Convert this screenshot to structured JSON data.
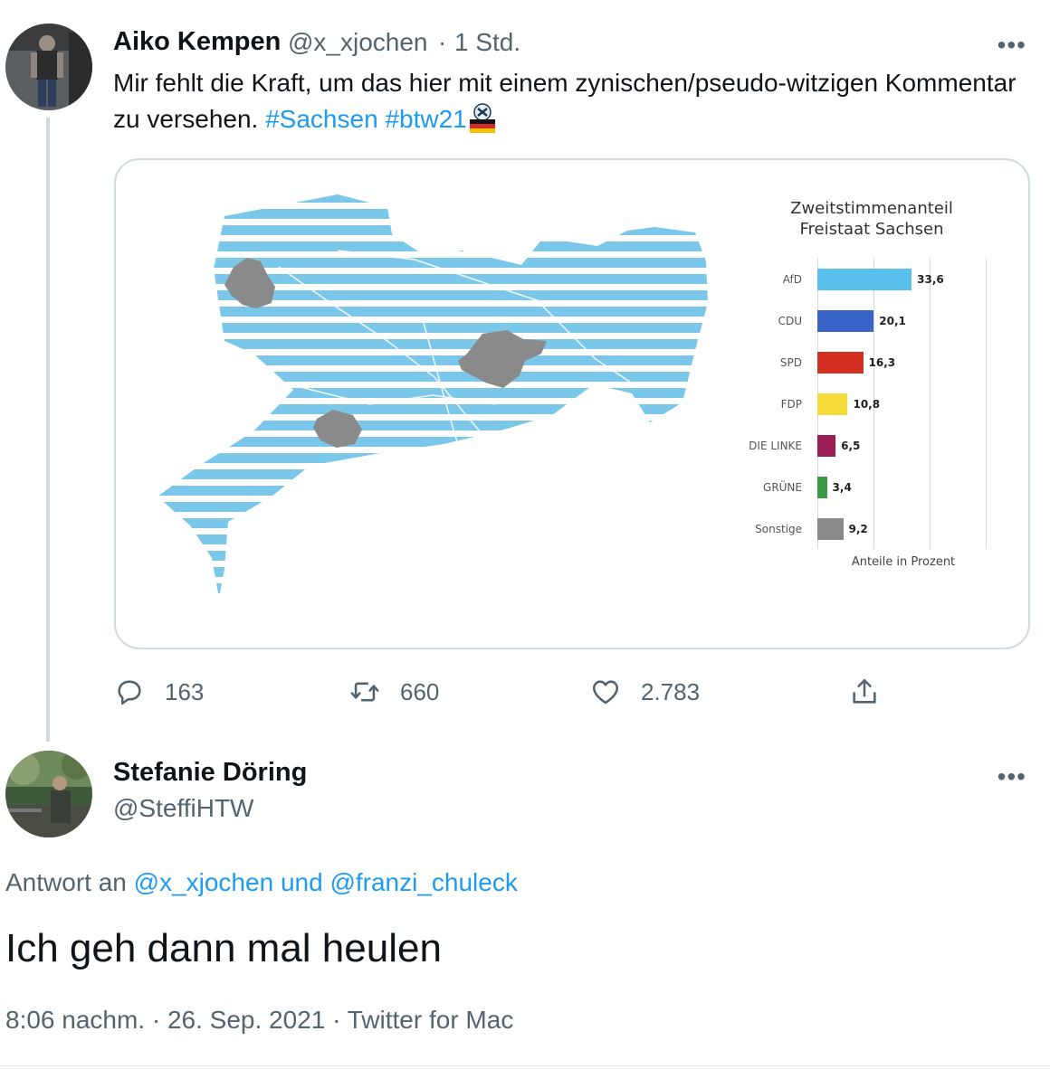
{
  "tweet1": {
    "author_name": "Aiko Kempen",
    "handle": "@x_xjochen",
    "separator": "·",
    "time": "1 Std.",
    "more": "•••",
    "text_main": "Mir fehlt die Kraft, um das hier mit einem zynischen/pseudo-witzigen Kommentar zu versehen.",
    "hashtags": [
      "#Sachsen",
      "#btw21"
    ],
    "actions": {
      "replies": "163",
      "retweets": "660",
      "likes": "2.783"
    },
    "media_chart": {
      "title_line1": "Zweitstimmenanteil",
      "title_line2": "Freistaat Sachsen",
      "caption": "Anteile in Prozent",
      "colors": {
        "map_stripes": "#7ac7ea",
        "map_cities": "#8a8a8a"
      }
    }
  },
  "tweet2": {
    "author_name": "Stefanie Döring",
    "handle": "@SteffiHTW",
    "more": "•••",
    "reply_prefix": "Antwort an",
    "reply_handle1": "@x_xjochen",
    "reply_conj": "und",
    "reply_handle2": "@franzi_chuleck",
    "text": "Ich geh dann mal heulen",
    "meta": "8:06 nachm. · 26. Sep. 2021 · Twitter for Mac"
  },
  "chart_data": {
    "type": "bar",
    "title": "Zweitstimmenanteil Freistaat Sachsen",
    "xlabel": "Anteile in Prozent",
    "ylabel": "",
    "categories": [
      "AfD",
      "CDU",
      "SPD",
      "FDP",
      "DIE LINKE",
      "GRÜNE",
      "Sonstige"
    ],
    "values": [
      33.6,
      20.1,
      16.3,
      10.8,
      6.5,
      3.4,
      9.2
    ],
    "value_labels": [
      "33,6",
      "20,1",
      "16,3",
      "10,8",
      "6,5",
      "3,4",
      "9,2"
    ],
    "colors": [
      "#5bbfee",
      "#3a65c8",
      "#d32f23",
      "#f5db3a",
      "#9c1d55",
      "#3a9a45",
      "#8a8a8a"
    ],
    "orientation": "horizontal",
    "xlim": [
      0,
      60
    ],
    "grid": true
  }
}
